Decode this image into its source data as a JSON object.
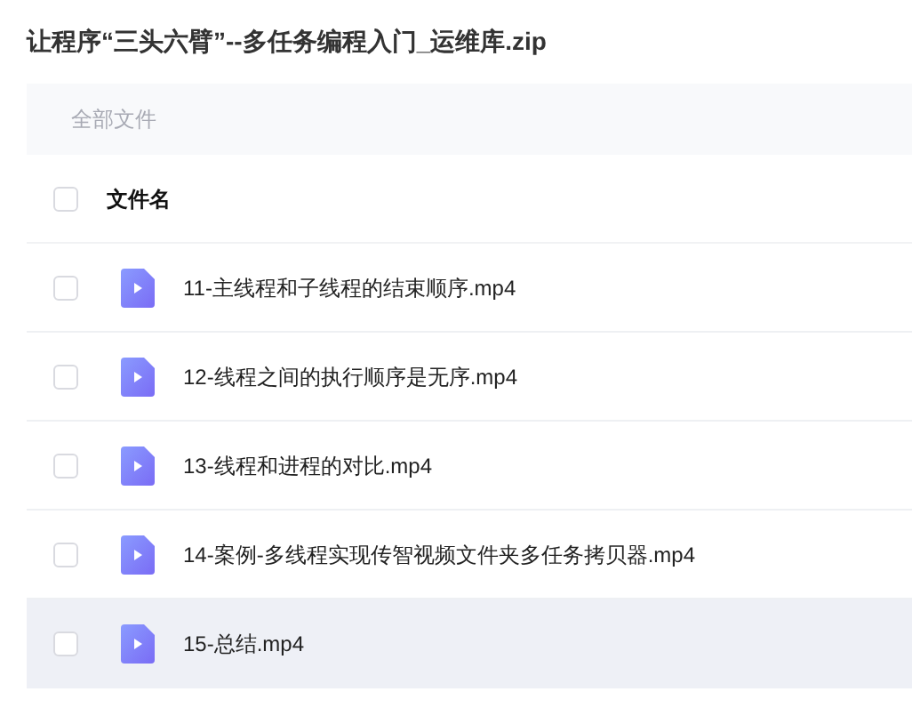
{
  "title": "让程序“三头六臂”--多任务编程入门_运维库.zip",
  "breadcrumb": "全部文件",
  "header": {
    "label": "文件名",
    "checked": false
  },
  "files": [
    {
      "name": "11-主线程和子线程的结束顺序.mp4",
      "checked": false,
      "selected": false
    },
    {
      "name": "12-线程之间的执行顺序是无序.mp4",
      "checked": false,
      "selected": false
    },
    {
      "name": "13-线程和进程的对比.mp4",
      "checked": false,
      "selected": false
    },
    {
      "name": "14-案例-多线程实现传智视频文件夹多任务拷贝器.mp4",
      "checked": false,
      "selected": false
    },
    {
      "name": "15-总结.mp4",
      "checked": false,
      "selected": true
    }
  ]
}
